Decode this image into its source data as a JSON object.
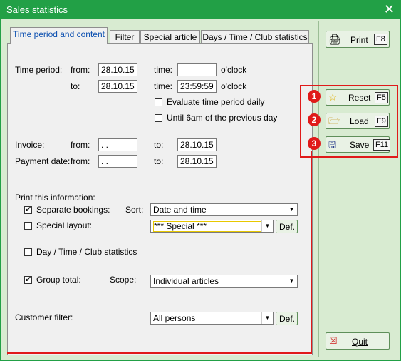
{
  "window": {
    "title": "Sales statistics",
    "close_glyph": "✕"
  },
  "tabs": [
    {
      "label": "Time period and content"
    },
    {
      "label": "Filter"
    },
    {
      "label": "Special article"
    },
    {
      "label": "Days / Time / Club statistics"
    }
  ],
  "time_period": {
    "label": "Time period:",
    "from_label": "from:",
    "to_label": "to:",
    "from_date": "28.10.15",
    "to_date": "28.10.15",
    "time_label": "time:",
    "from_time": "",
    "to_time": "23:59:59",
    "oclock": "o'clock",
    "evaluate_daily": {
      "label": "Evaluate time period daily",
      "checked": false
    },
    "until_6am": {
      "label": "Until 6am of the previous day",
      "checked": false
    }
  },
  "invoice": {
    "label": "Invoice:",
    "from_label": "from:",
    "from_value": " . .",
    "to_label": "to:",
    "to_value": "28.10.15"
  },
  "payment_date": {
    "label": "Payment date:",
    "from_label": "from:",
    "from_value": " . .",
    "to_label": "to:",
    "to_value": "28.10.15"
  },
  "print_info": {
    "heading": "Print this information:",
    "separate_bookings": {
      "label": "Separate bookings:",
      "checked": true
    },
    "sort_label": "Sort:",
    "sort_value": "Date and time",
    "special_layout": {
      "label": "Special layout:",
      "checked": false
    },
    "special_value": "*** Special ***",
    "def_label": "Def.",
    "day_time_club": {
      "label": "Day / Time / Club statistics",
      "checked": false
    },
    "group_total": {
      "label": "Group total:",
      "checked": true
    },
    "scope_label": "Scope:",
    "scope_value": "Individual articles"
  },
  "customer_filter": {
    "label": "Customer filter:",
    "value": "All persons",
    "def_label": "Def."
  },
  "buttons": {
    "print": {
      "label": "Print",
      "key": "F8",
      "icon": "printer-icon"
    },
    "reset": {
      "label": "Reset",
      "key": "F5",
      "icon": "star-icon",
      "badge": "1"
    },
    "load": {
      "label": "Load",
      "key": "F9",
      "icon": "folder-open-icon",
      "badge": "2"
    },
    "save": {
      "label": "Save",
      "key": "F11",
      "icon": "floppy-disk-icon",
      "badge": "3"
    },
    "quit": {
      "label": "Quit",
      "icon": "close-box-icon"
    }
  },
  "colors": {
    "title_bar": "#22a046",
    "highlight": "#e01a1a",
    "panel_bg": "#d8ebd1"
  }
}
